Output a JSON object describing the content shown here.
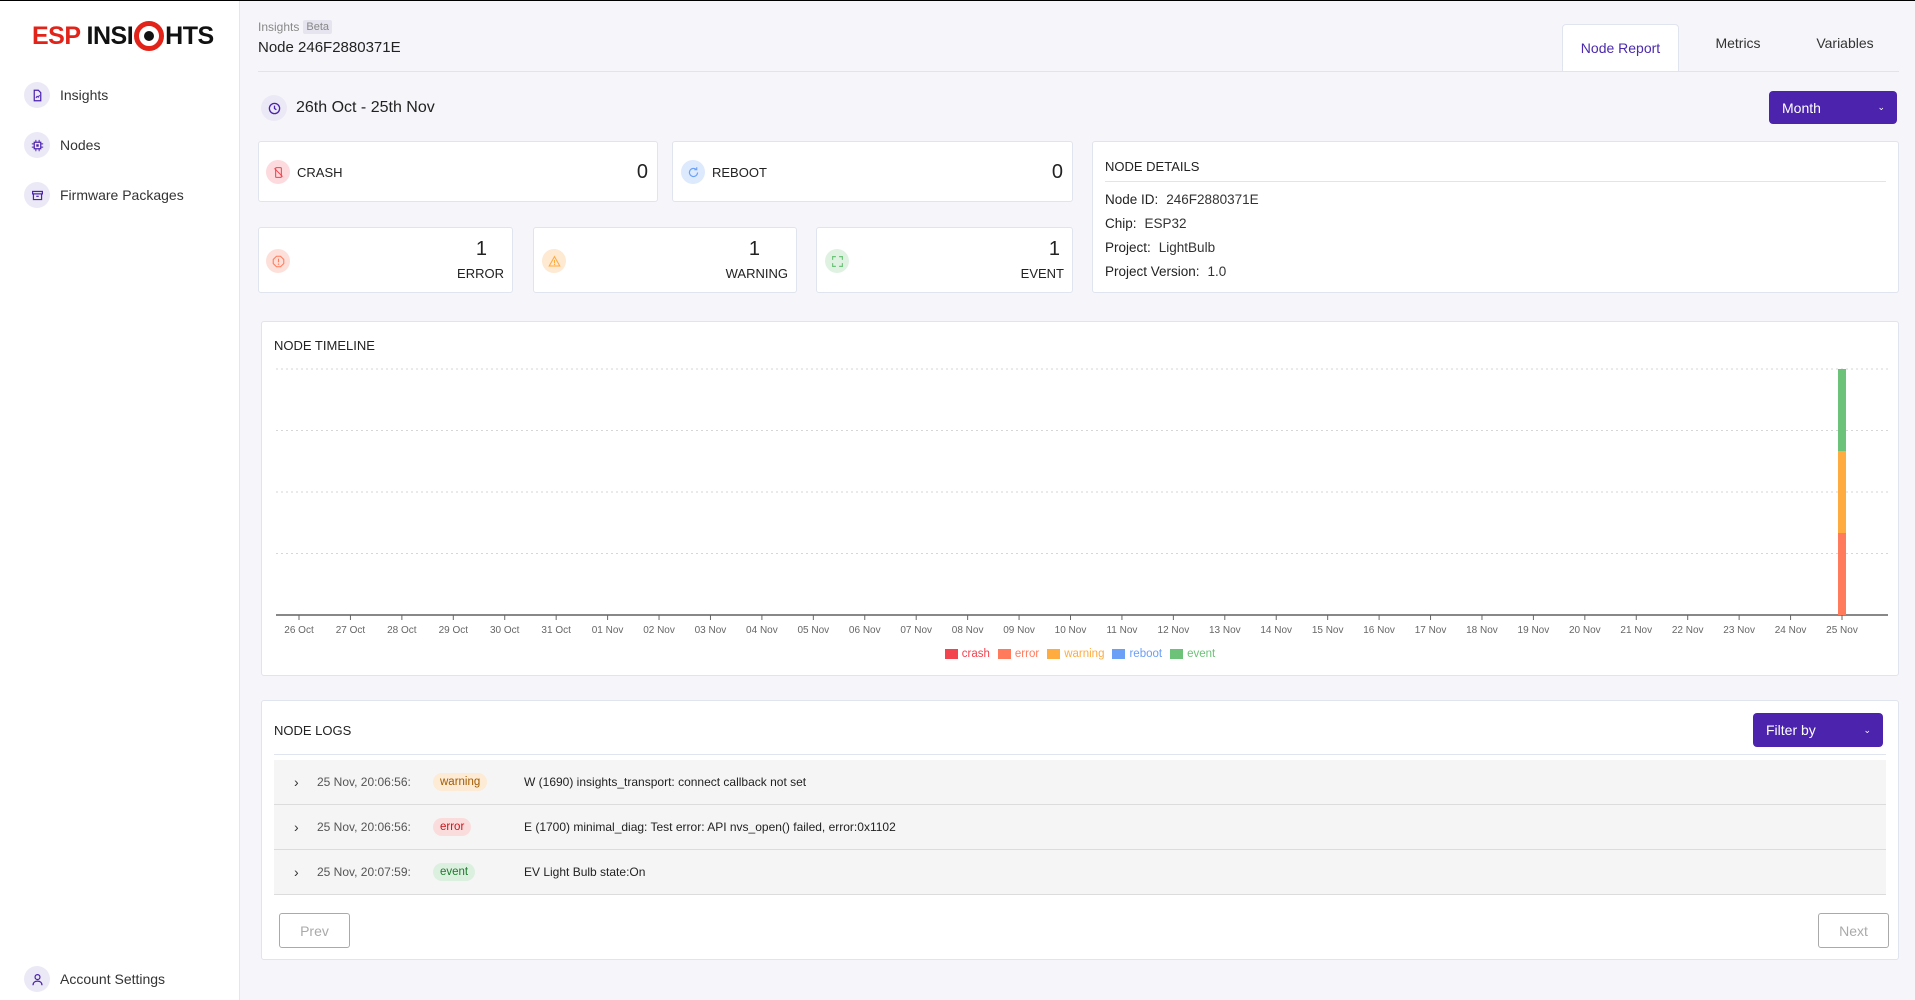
{
  "sidebar": {
    "logo": {
      "part1": "ESP",
      "part2": "INSI",
      "part3": "HTS"
    },
    "items": [
      {
        "label": "Insights",
        "icon": "insights-doc-icon"
      },
      {
        "label": "Nodes",
        "icon": "chip-icon"
      },
      {
        "label": "Firmware Packages",
        "icon": "package-icon"
      }
    ],
    "account": {
      "label": "Account Settings",
      "icon": "user-icon"
    }
  },
  "header": {
    "breadcrumb": "Insights",
    "badge": "Beta",
    "title": "Node 246F2880371E",
    "tabs": [
      {
        "label": "Node Report",
        "active": true
      },
      {
        "label": "Metrics",
        "active": false
      },
      {
        "label": "Variables",
        "active": false
      }
    ]
  },
  "date_range": {
    "label": "26th Oct - 25th Nov",
    "period": "Month"
  },
  "stats": {
    "crash": {
      "label": "CRASH",
      "value": "0",
      "color": "#f2434e"
    },
    "reboot": {
      "label": "REBOOT",
      "value": "0",
      "color": "#6aa0f5"
    },
    "error": {
      "label": "ERROR",
      "value": "1",
      "color": "#ff7b5c"
    },
    "warning": {
      "label": "WARNING",
      "value": "1",
      "color": "#ffab40"
    },
    "event": {
      "label": "EVENT",
      "value": "1",
      "color": "#6cc278"
    }
  },
  "node_details": {
    "title": "NODE DETAILS",
    "rows": [
      {
        "label": "Node ID:",
        "value": "246F2880371E"
      },
      {
        "label": "Chip:",
        "value": "ESP32"
      },
      {
        "label": "Project:",
        "value": "LightBulb"
      },
      {
        "label": "Project Version:",
        "value": "1.0"
      }
    ]
  },
  "timeline": {
    "title": "NODE TIMELINE"
  },
  "chart_data": {
    "type": "bar",
    "stacked": true,
    "title": "NODE TIMELINE",
    "xlabel": "",
    "ylabel": "",
    "categories": [
      "26 Oct",
      "27 Oct",
      "28 Oct",
      "29 Oct",
      "30 Oct",
      "31 Oct",
      "01 Nov",
      "02 Nov",
      "03 Nov",
      "04 Nov",
      "05 Nov",
      "06 Nov",
      "07 Nov",
      "08 Nov",
      "09 Nov",
      "10 Nov",
      "11 Nov",
      "12 Nov",
      "13 Nov",
      "14 Nov",
      "15 Nov",
      "16 Nov",
      "17 Nov",
      "18 Nov",
      "19 Nov",
      "20 Nov",
      "21 Nov",
      "22 Nov",
      "23 Nov",
      "24 Nov",
      "25 Nov"
    ],
    "series": [
      {
        "name": "crash",
        "color": "#f2434e",
        "values": [
          0,
          0,
          0,
          0,
          0,
          0,
          0,
          0,
          0,
          0,
          0,
          0,
          0,
          0,
          0,
          0,
          0,
          0,
          0,
          0,
          0,
          0,
          0,
          0,
          0,
          0,
          0,
          0,
          0,
          0,
          0
        ]
      },
      {
        "name": "error",
        "color": "#ff7b5c",
        "values": [
          0,
          0,
          0,
          0,
          0,
          0,
          0,
          0,
          0,
          0,
          0,
          0,
          0,
          0,
          0,
          0,
          0,
          0,
          0,
          0,
          0,
          0,
          0,
          0,
          0,
          0,
          0,
          0,
          0,
          0,
          1
        ]
      },
      {
        "name": "warning",
        "color": "#ffab40",
        "values": [
          0,
          0,
          0,
          0,
          0,
          0,
          0,
          0,
          0,
          0,
          0,
          0,
          0,
          0,
          0,
          0,
          0,
          0,
          0,
          0,
          0,
          0,
          0,
          0,
          0,
          0,
          0,
          0,
          0,
          0,
          1
        ]
      },
      {
        "name": "reboot",
        "color": "#6aa0f5",
        "values": [
          0,
          0,
          0,
          0,
          0,
          0,
          0,
          0,
          0,
          0,
          0,
          0,
          0,
          0,
          0,
          0,
          0,
          0,
          0,
          0,
          0,
          0,
          0,
          0,
          0,
          0,
          0,
          0,
          0,
          0,
          0
        ]
      },
      {
        "name": "event",
        "color": "#6cc278",
        "values": [
          0,
          0,
          0,
          0,
          0,
          0,
          0,
          0,
          0,
          0,
          0,
          0,
          0,
          0,
          0,
          0,
          0,
          0,
          0,
          0,
          0,
          0,
          0,
          0,
          0,
          0,
          0,
          0,
          0,
          0,
          1
        ]
      }
    ],
    "ylim": [
      0,
      3
    ],
    "grid": true,
    "legend": "bottom-center"
  },
  "logs": {
    "title": "NODE LOGS",
    "filter_label": "Filter by",
    "rows": [
      {
        "time": "25 Nov, 20:06:56:",
        "level": "warning",
        "message": "W (1690) insights_transport: connect callback not set"
      },
      {
        "time": "25 Nov, 20:06:56:",
        "level": "error",
        "message": "E (1700) minimal_diag: Test error: API nvs_open() failed, error:0x1102"
      },
      {
        "time": "25 Nov, 20:07:59:",
        "level": "event",
        "message": "EV Light Bulb state:On"
      }
    ],
    "badge_colors": {
      "warning": {
        "bg": "#fdebd5",
        "fg": "#a35a00"
      },
      "error": {
        "bg": "#fbdcdc",
        "fg": "#c4161c"
      },
      "event": {
        "bg": "#dcf0df",
        "fg": "#1d7a2c"
      }
    },
    "prev_label": "Prev",
    "next_label": "Next"
  },
  "colors": {
    "accent": "#4b23ad"
  }
}
